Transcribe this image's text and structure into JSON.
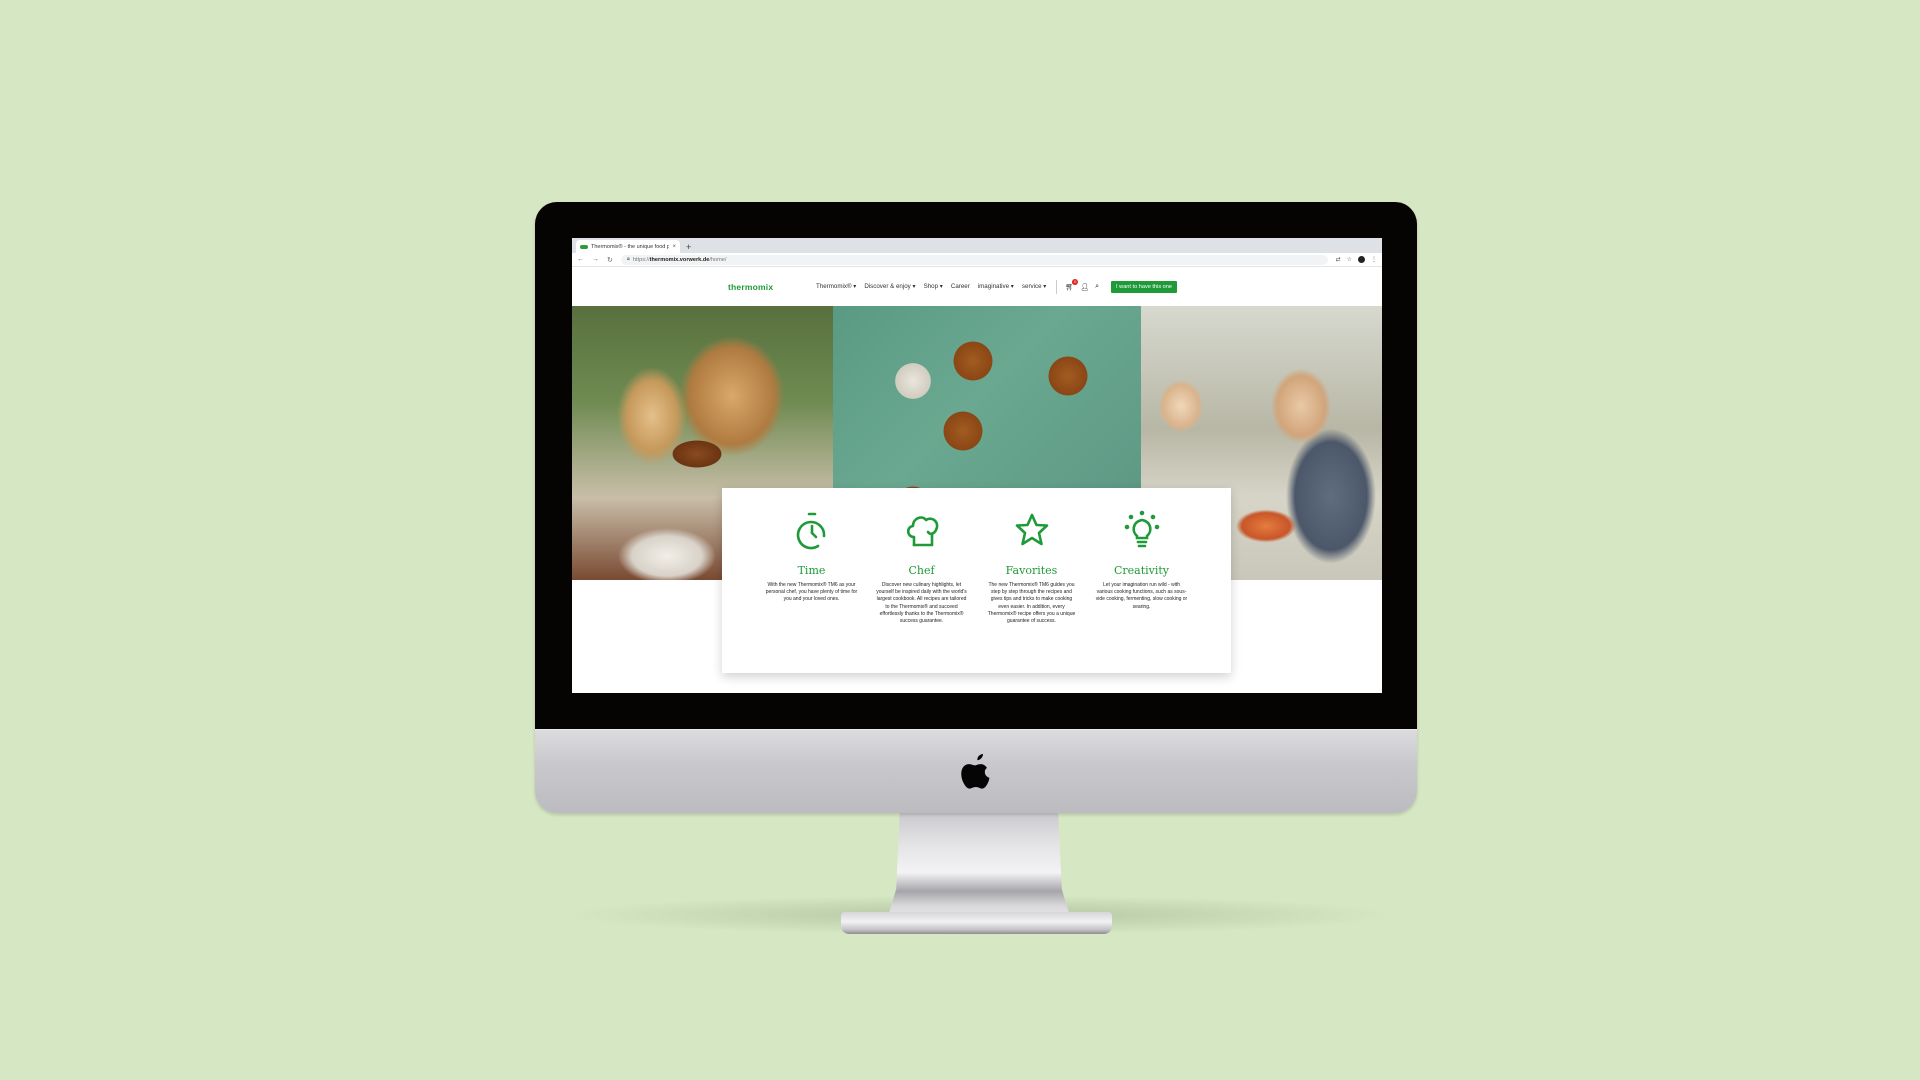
{
  "browser": {
    "tab_title": "Thermomix® - the unique food processor",
    "tab_close": "×",
    "new_tab": "+",
    "url_scheme": "https://",
    "url_host": "thermomix.vorwerk.de",
    "url_path": "/home/"
  },
  "site": {
    "logo": "thermomix",
    "nav": [
      {
        "label": "Thermomix® ▾"
      },
      {
        "label": "Discover & enjoy ▾"
      },
      {
        "label": "Shop ▾"
      },
      {
        "label": "Career"
      },
      {
        "label": "imaginative ▾"
      },
      {
        "label": "service ▾"
      }
    ],
    "cart_count": "0",
    "cta_label": "I want to have this one"
  },
  "features": [
    {
      "icon": "stopwatch-icon",
      "title": "Time",
      "text": "With the new Thermomix® TM6 as your personal chef, you have plenty of time for you and your loved ones."
    },
    {
      "icon": "chef-hat-icon",
      "title": "Chef",
      "text": "Discover new culinary highlights, let yourself be inspired daily with the world's largest cookbook. All recipes are tailored to the Thermomix® and succeed effortlessly thanks to the Thermomix® success guarantee."
    },
    {
      "icon": "star-icon",
      "title": "Favorites",
      "text": "The new Thermomix® TM6 guides you step by step through the recipes and gives tips and tricks to make cooking even easier. In addition, every Thermomix® recipe offers you a unique guarantee of success."
    },
    {
      "icon": "lightbulb-icon",
      "title": "Creativity",
      "text": "Let your imagination run wild - with various cooking functions, such as sous-vide cooking, fermenting, slow cooking or searing."
    }
  ],
  "colors": {
    "brand_green": "#1f9a38",
    "background": "#d6e7c3"
  }
}
